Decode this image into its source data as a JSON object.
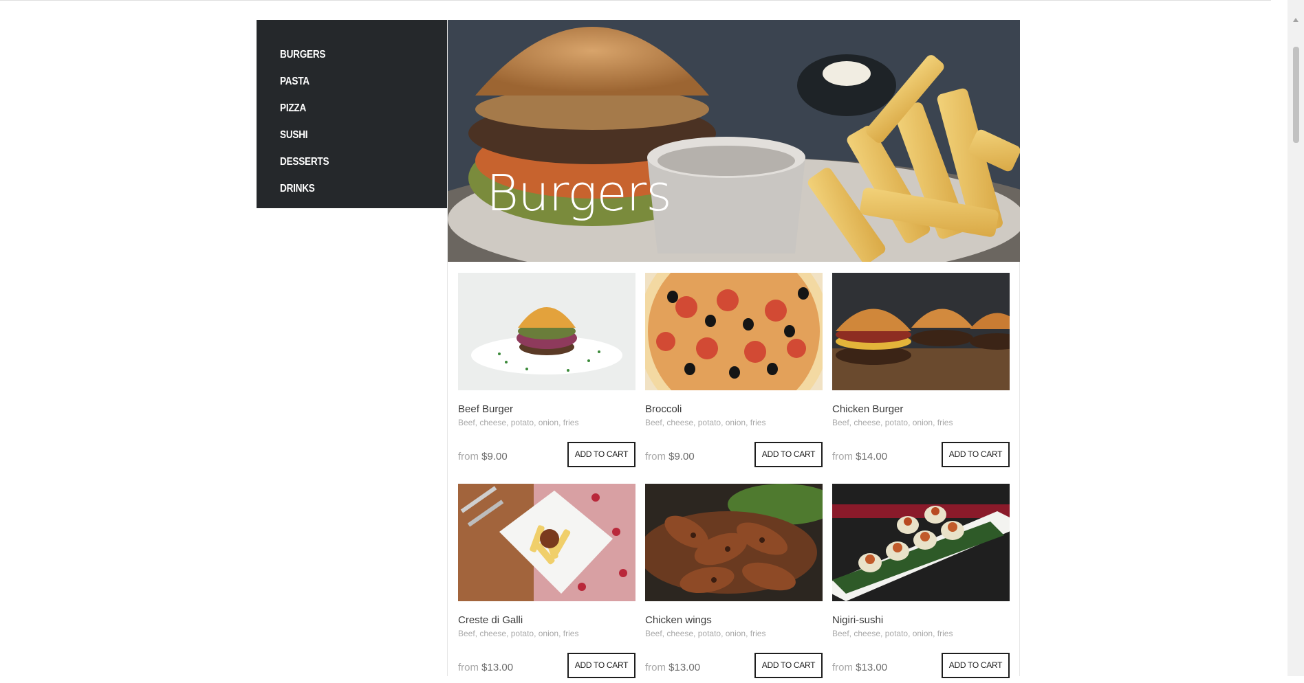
{
  "sidebar": {
    "items": [
      {
        "label": "BURGERS"
      },
      {
        "label": "PASTA"
      },
      {
        "label": "PIZZA"
      },
      {
        "label": "SUSHI"
      },
      {
        "label": "DESSERTS"
      },
      {
        "label": "DRINKS"
      }
    ]
  },
  "hero": {
    "title": "Burgers"
  },
  "products": [
    {
      "name": "Beef Burger",
      "desc": "Beef, cheese, potato, onion, fries",
      "from": "from",
      "price": "$9.00",
      "button": "ADD TO CART",
      "image": "burger"
    },
    {
      "name": "Broccoli",
      "desc": "Beef, cheese, potato, onion, fries",
      "from": "from",
      "price": "$9.00",
      "button": "ADD TO CART",
      "image": "pizza"
    },
    {
      "name": "Chicken Burger",
      "desc": "Beef, cheese, potato, onion, fries",
      "from": "from",
      "price": "$14.00",
      "button": "ADD TO CART",
      "image": "sliders"
    },
    {
      "name": "Creste di Galli",
      "desc": "Beef, cheese, potato, onion, fries",
      "from": "from",
      "price": "$13.00",
      "button": "ADD TO CART",
      "image": "pasta"
    },
    {
      "name": "Chicken wings",
      "desc": "Beef, cheese, potato, onion, fries",
      "from": "from",
      "price": "$13.00",
      "button": "ADD TO CART",
      "image": "wings"
    },
    {
      "name": "Nigiri-sushi",
      "desc": "Beef, cheese, potato, onion, fries",
      "from": "from",
      "price": "$13.00",
      "button": "ADD TO CART",
      "image": "sushi"
    }
  ],
  "colors": {
    "sidebar_bg": "#25282b",
    "text_dark": "#3a3a3a",
    "text_muted": "#a8a8a8",
    "button_border": "#1e1e1e"
  }
}
